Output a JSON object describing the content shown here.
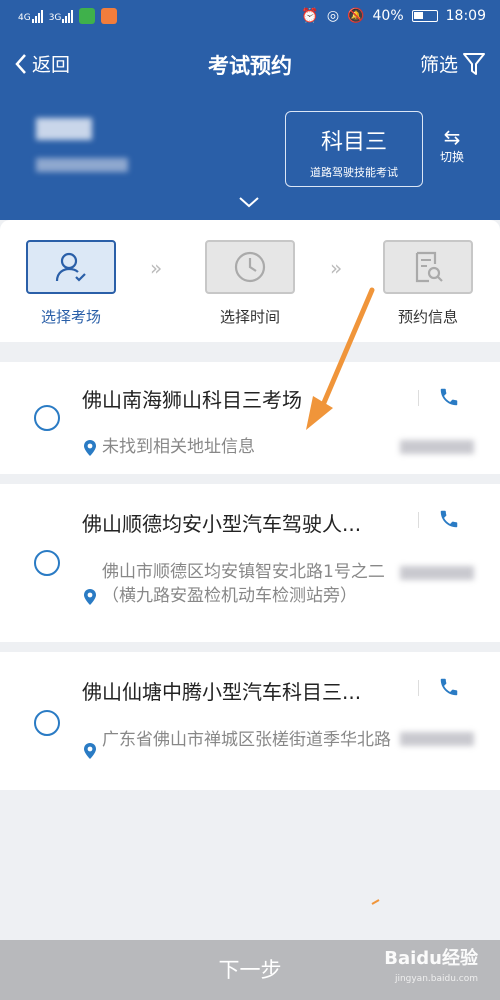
{
  "status_bar": {
    "signal1": "4G",
    "signal2": "3G",
    "battery": "40%",
    "time": "18:09"
  },
  "header": {
    "back_label": "返回",
    "title": "考试预约",
    "filter_label": "筛选",
    "subject": {
      "name": "科目三",
      "desc": "道路驾驶技能考试"
    },
    "switch_label": "切换"
  },
  "steps": [
    {
      "label": "选择考场",
      "icon": "person-check-icon",
      "active": true
    },
    {
      "label": "选择时间",
      "icon": "clock-icon",
      "active": false
    },
    {
      "label": "预约信息",
      "icon": "document-search-icon",
      "active": false
    }
  ],
  "venues": [
    {
      "name": "佛山南海狮山科目三考场",
      "address": "未找到相关地址信息"
    },
    {
      "name": "佛山顺德均安小型汽车驾驶人...",
      "address": "佛山市顺德区均安镇智安北路1号之二（横九路安盈检机动车检测站旁）"
    },
    {
      "name": "佛山仙塘中腾小型汽车科目三...",
      "address": "广东省佛山市禅城区张槎街道季华北路"
    }
  ],
  "footer": {
    "next_label": "下一步"
  },
  "watermark": {
    "brand": "Baidu经验",
    "url": "jingyan.baidu.com"
  },
  "colors": {
    "brand_blue": "#2a5fa8",
    "radio_blue": "#2a7bc4",
    "annotation_orange": "#f0953a",
    "footer_gray": "#b8b9bc"
  }
}
